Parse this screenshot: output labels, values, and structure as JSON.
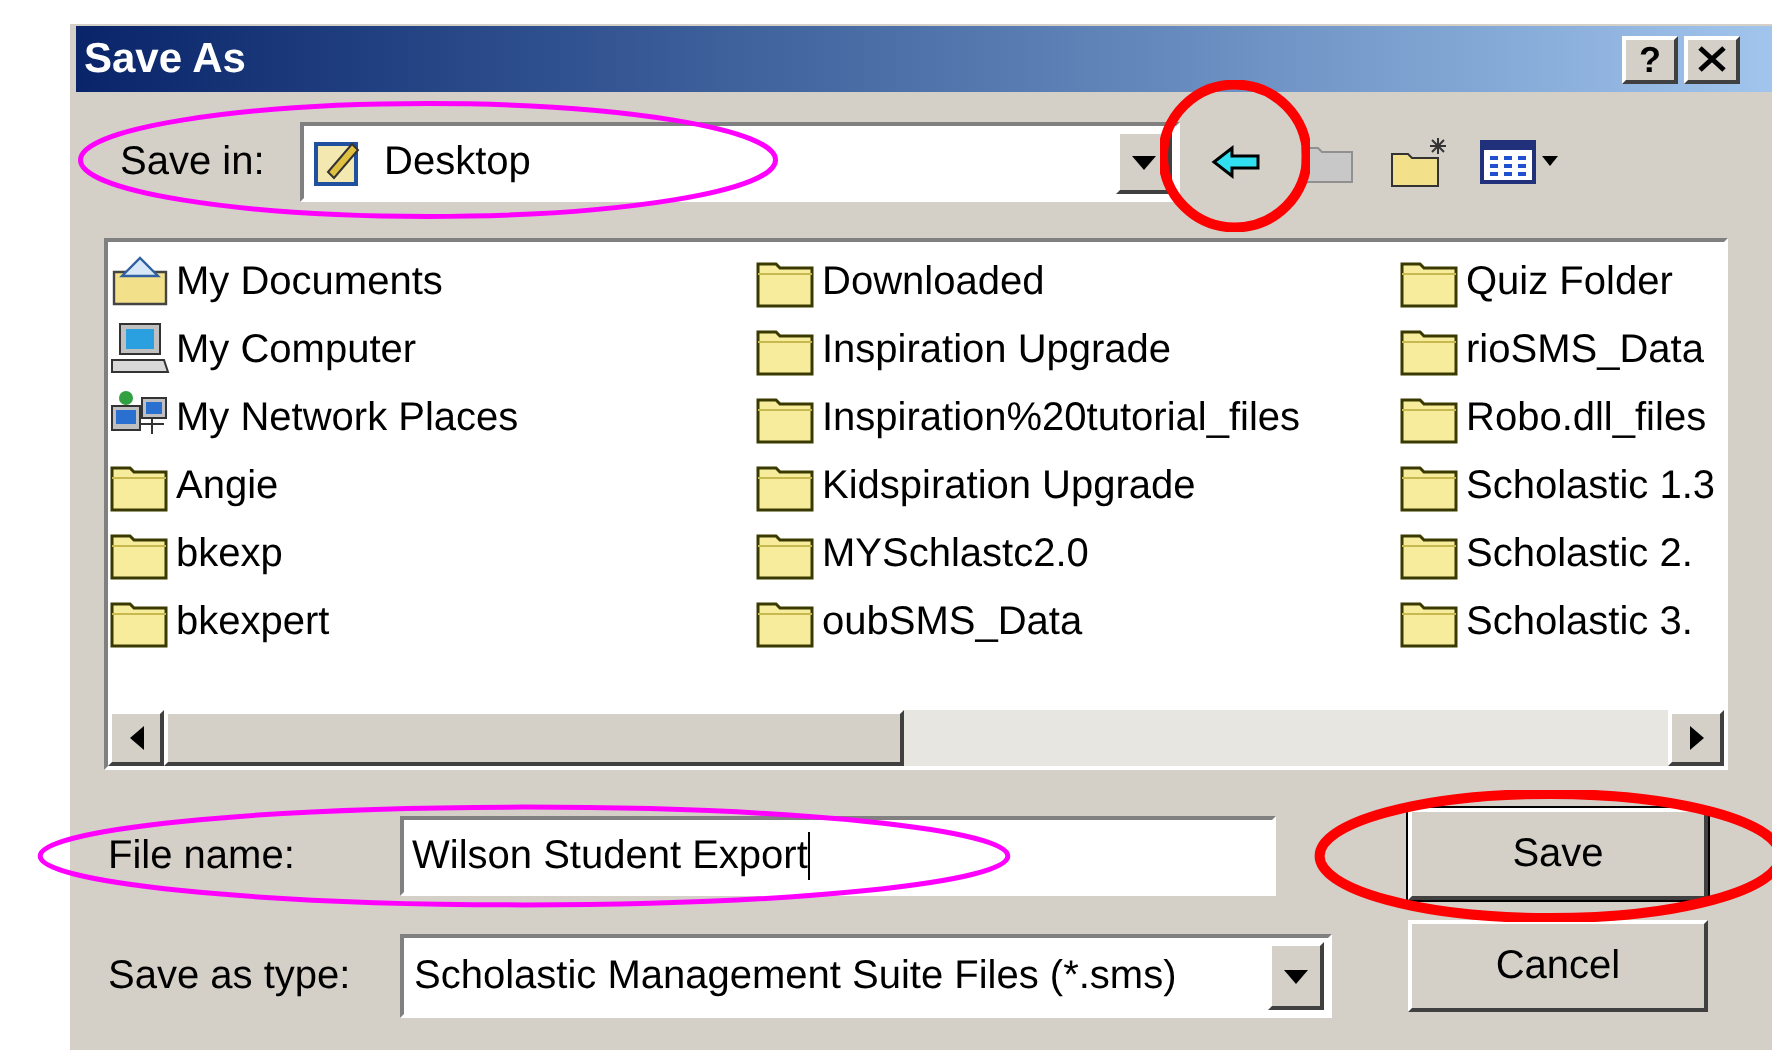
{
  "window": {
    "title": "Save As",
    "help_label": "?"
  },
  "save_in": {
    "label": "Save in:",
    "value": "Desktop"
  },
  "toolbar": [
    {
      "kind": "back",
      "disabled": false
    },
    {
      "kind": "up",
      "disabled": true
    },
    {
      "kind": "new-folder",
      "disabled": false
    },
    {
      "kind": "views",
      "disabled": false
    }
  ],
  "files": [
    {
      "name": "My Documents",
      "kind": "documents"
    },
    {
      "name": "My Computer",
      "kind": "computer"
    },
    {
      "name": "My Network Places",
      "kind": "network"
    },
    {
      "name": "Angie",
      "kind": "folder"
    },
    {
      "name": "bkexp",
      "kind": "folder"
    },
    {
      "name": "bkexpert",
      "kind": "folder"
    },
    {
      "name": "Downloaded",
      "kind": "folder"
    },
    {
      "name": "Inspiration Upgrade",
      "kind": "folder"
    },
    {
      "name": "Inspiration%20tutorial_files",
      "kind": "folder"
    },
    {
      "name": "Kidspiration Upgrade",
      "kind": "folder"
    },
    {
      "name": "MYSchlastc2.0",
      "kind": "folder"
    },
    {
      "name": "oubSMS_Data",
      "kind": "folder"
    },
    {
      "name": "Quiz Folder",
      "kind": "folder"
    },
    {
      "name": "rioSMS_Data",
      "kind": "folder"
    },
    {
      "name": "Robo.dll_files",
      "kind": "folder"
    },
    {
      "name": "Scholastic 1.3",
      "kind": "folder"
    },
    {
      "name": "Scholastic 2.",
      "kind": "folder"
    },
    {
      "name": "Scholastic 3.",
      "kind": "folder"
    }
  ],
  "file_name": {
    "label": "File name:",
    "value": "Wilson Student Export"
  },
  "save_as_type": {
    "label": "Save as type:",
    "value": "Scholastic Management Suite Files (*.sms)"
  },
  "buttons": [
    {
      "label": "Save",
      "default": true
    },
    {
      "label": "Cancel",
      "default": false
    }
  ],
  "annotations": [
    {
      "kind": "ellipse",
      "color": "#ff00ff"
    },
    {
      "kind": "circle",
      "color": "#ff0000"
    },
    {
      "kind": "ellipse",
      "color": "#ff00ff"
    },
    {
      "kind": "circle",
      "color": "#ff0000"
    }
  ]
}
